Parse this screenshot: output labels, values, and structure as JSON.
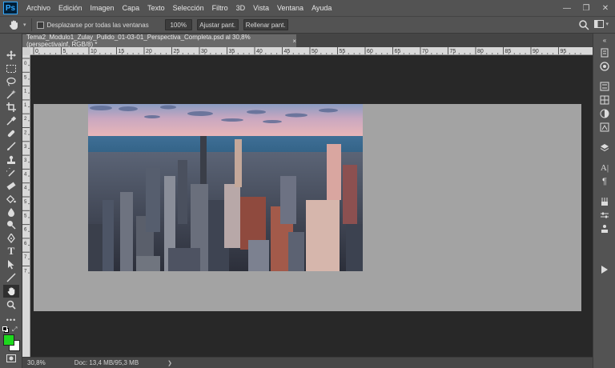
{
  "menu": {
    "logo": "Ps",
    "items": [
      "Archivo",
      "Edición",
      "Imagen",
      "Capa",
      "Texto",
      "Selección",
      "Filtro",
      "3D",
      "Vista",
      "Ventana",
      "Ayuda"
    ]
  },
  "window_controls": {
    "minimize": "—",
    "restore": "❐",
    "close": "✕"
  },
  "options_bar": {
    "scroll_all_label": "Desplazarse por todas las ventanas",
    "zoom_100": "100%",
    "fit_screen": "Ajustar pant.",
    "fill_screen": "Rellenar pant."
  },
  "document_tab": {
    "title": "Tema2_Modulo1_Zulay_Pulido_01-03-01_Perspectiva_Completa.psd al 30,8% (perspectivainf, RGB/8) *",
    "close": "×"
  },
  "ruler": {
    "top_labels": [
      "0",
      "5",
      "10",
      "15",
      "20",
      "25",
      "30",
      "35",
      "40",
      "45",
      "50",
      "55",
      "60",
      "65",
      "70",
      "75",
      "80",
      "85",
      "90",
      "95"
    ],
    "left_labels": [
      "0",
      "5",
      "1",
      "1",
      "2",
      "2",
      "3",
      "3",
      "4",
      "4",
      "5",
      "5",
      "6",
      "6",
      "7",
      "7"
    ]
  },
  "status": {
    "zoom": "30,8%",
    "doc_info": "Doc: 13,4 MB/95,3 MB",
    "arrow": "❯"
  },
  "colors": {
    "foreground": "#1ed81e",
    "background": "#ffffff",
    "canvas": "#a3a3a3",
    "workspace": "#282828",
    "ui": "#535353"
  }
}
